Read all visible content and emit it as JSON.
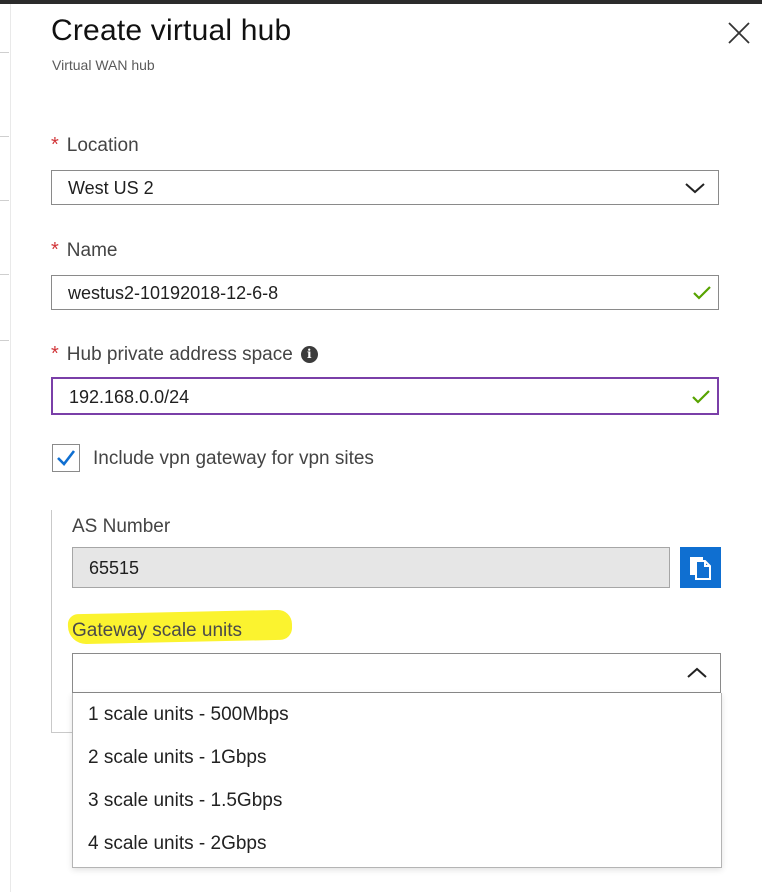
{
  "blade": {
    "title": "Create virtual hub",
    "subtitle": "Virtual WAN hub",
    "close_icon": "close-icon"
  },
  "form": {
    "required_mark": "*",
    "location": {
      "label": "Location",
      "value": "West US 2",
      "icon": "chevron-down-icon"
    },
    "name": {
      "label": "Name",
      "value": "westus2-10192018-12-6-8",
      "valid": true,
      "icon": "checkmark-icon"
    },
    "address_space": {
      "label": "Hub private address space",
      "value": "192.168.0.0/24",
      "valid": true,
      "info_icon": "info-icon",
      "focus_color": "#7a3fa8"
    },
    "vpn_gateway": {
      "label": "Include vpn gateway for vpn sites",
      "checked": true,
      "check_color": "#0f6fd1"
    },
    "as_number": {
      "label": "AS Number",
      "value": "65515",
      "copy_icon": "copy-icon",
      "button_color": "#0f6fd1"
    },
    "gateway_scale_units": {
      "label": "Gateway scale units",
      "highlight_color": "#fbf32f",
      "value": "",
      "expanded": true,
      "icon": "chevron-up-icon",
      "options": [
        "1 scale units - 500Mbps",
        "2 scale units - 1Gbps",
        "3 scale units - 1.5Gbps",
        "4 scale units - 2Gbps"
      ]
    }
  }
}
